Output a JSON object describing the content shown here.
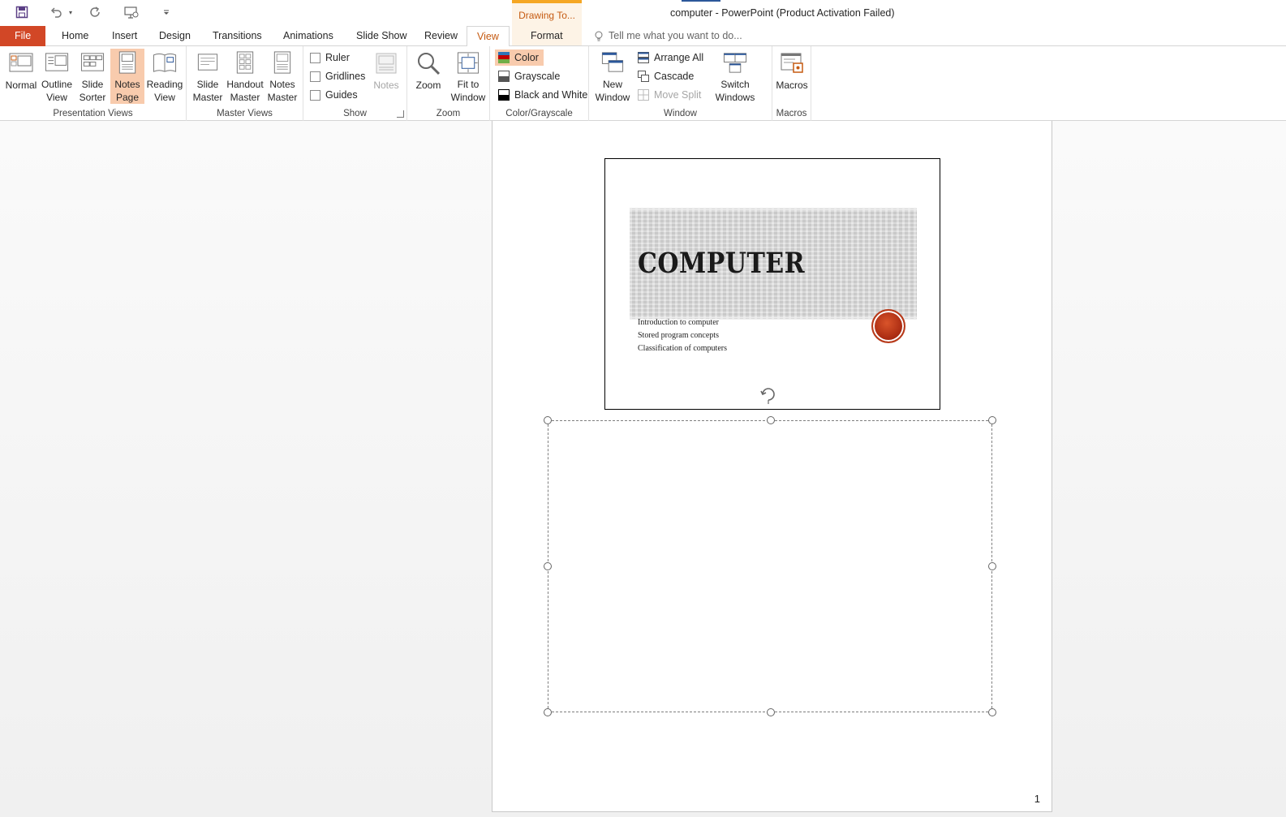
{
  "window": {
    "title": "computer - PowerPoint (Product Activation Failed)",
    "context_tab_group": "Drawing To..."
  },
  "tabs": [
    {
      "label": "File"
    },
    {
      "label": "Home"
    },
    {
      "label": "Insert"
    },
    {
      "label": "Design"
    },
    {
      "label": "Transitions"
    },
    {
      "label": "Animations"
    },
    {
      "label": "Slide Show"
    },
    {
      "label": "Review"
    },
    {
      "label": "View",
      "active": true
    },
    {
      "label": "Format"
    }
  ],
  "tell_me": {
    "placeholder": "Tell me what you want to do..."
  },
  "ribbon": {
    "presentation_views": {
      "label": "Presentation Views",
      "normal": [
        "Normal",
        ""
      ],
      "outline": [
        "Outline",
        "View"
      ],
      "sorter": [
        "Slide",
        "Sorter"
      ],
      "notes_page": [
        "Notes",
        "Page"
      ],
      "reading": [
        "Reading",
        "View"
      ]
    },
    "master_views": {
      "label": "Master Views",
      "slide_master": [
        "Slide",
        "Master"
      ],
      "handout_master": [
        "Handout",
        "Master"
      ],
      "notes_master": [
        "Notes",
        "Master"
      ]
    },
    "show": {
      "label": "Show",
      "ruler": "Ruler",
      "gridlines": "Gridlines",
      "guides": "Guides",
      "notes": "Notes"
    },
    "zoom": {
      "label": "Zoom",
      "zoom": "Zoom",
      "fit": [
        "Fit to",
        "Window"
      ]
    },
    "color": {
      "label": "Color/Grayscale",
      "color": "Color",
      "grayscale": "Grayscale",
      "bw": "Black and White"
    },
    "window": {
      "label": "Window",
      "new_window": [
        "New",
        "Window"
      ],
      "arrange_all": "Arrange All",
      "cascade": "Cascade",
      "move_split": "Move Split",
      "switch": [
        "Switch",
        "Windows"
      ]
    },
    "macros": {
      "label": "Macros",
      "macros": "Macros"
    }
  },
  "slide": {
    "title": "COMPUTER",
    "bullets": [
      "Introduction to computer",
      "Stored program concepts",
      "Classification of computers"
    ]
  },
  "page_number": "1",
  "colors": {
    "file_tab": "#d24726",
    "accent": "#c55a11",
    "selected": "#f8cbad"
  }
}
